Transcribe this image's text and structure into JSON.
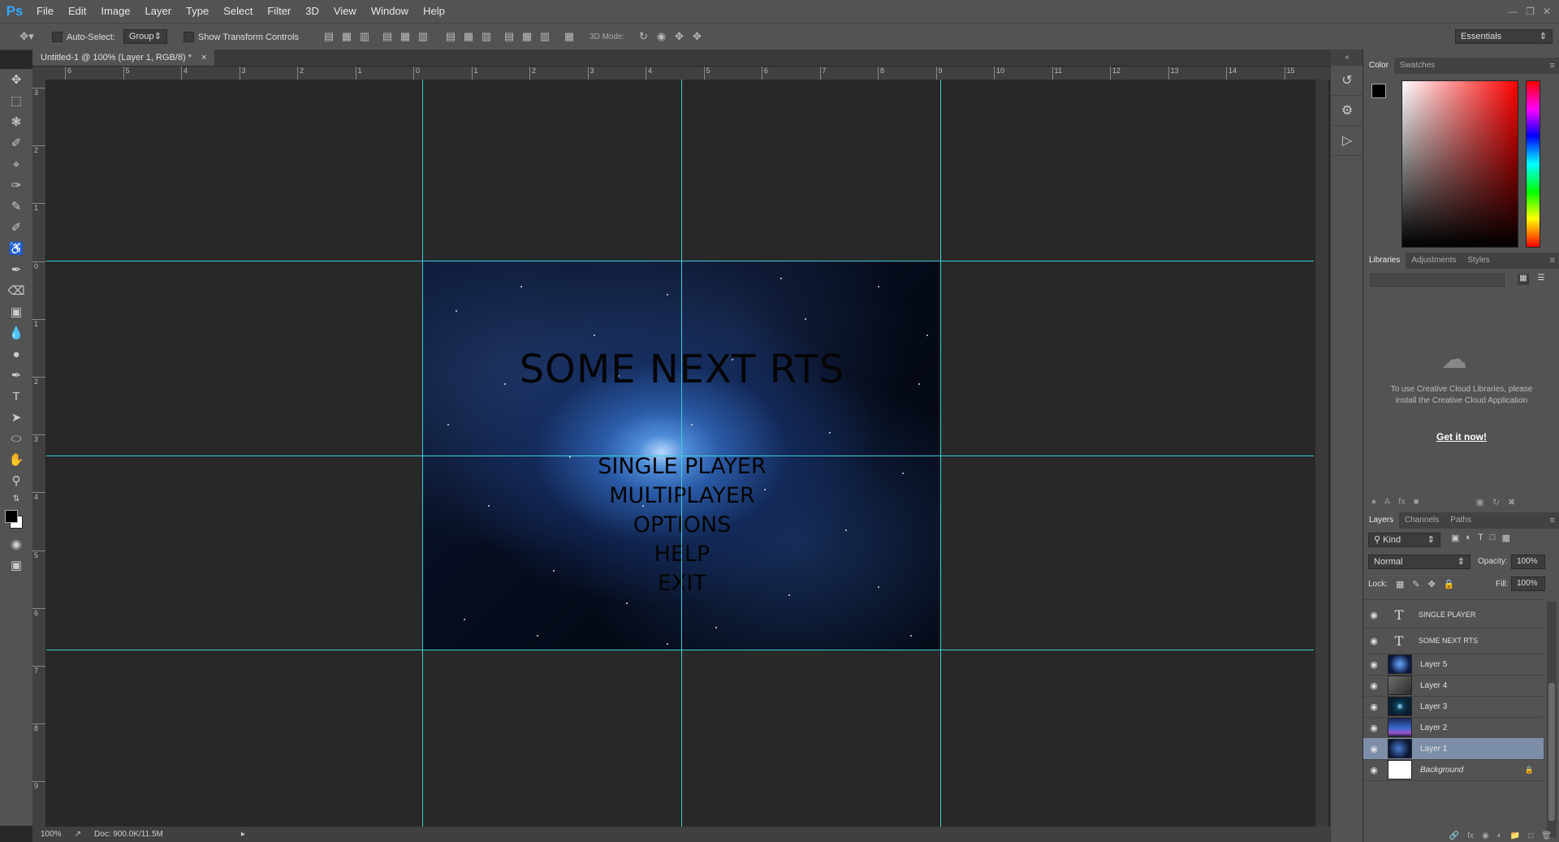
{
  "app": {
    "logo": "Ps",
    "menu": [
      "File",
      "Edit",
      "Image",
      "Layer",
      "Type",
      "Select",
      "Filter",
      "3D",
      "View",
      "Window",
      "Help"
    ],
    "window_controls": [
      "minimize-icon",
      "restore-icon",
      "close-icon"
    ]
  },
  "options_bar": {
    "auto_select_label": "Auto-Select:",
    "auto_select_value": "Group",
    "transform_label": "Show Transform Controls",
    "mode_3d_label": "3D Mode:",
    "workspace": "Essentials"
  },
  "document": {
    "tab_title": "Untitled-1 @ 100% (Layer 1, RGB/8) *",
    "close": "×",
    "zoom": "100%",
    "doc_info": "Doc: 900.0K/11.5M"
  },
  "rulers": {
    "h": [
      "6",
      "5",
      "4",
      "3",
      "2",
      "1",
      "0",
      "1",
      "2",
      "3",
      "4",
      "5",
      "6",
      "7",
      "8",
      "9",
      "10",
      "11",
      "12",
      "13",
      "14",
      "15"
    ],
    "v": [
      "3",
      "2",
      "1",
      "0",
      "1",
      "2",
      "3",
      "4",
      "5",
      "6",
      "7",
      "8",
      "9"
    ]
  },
  "artwork": {
    "title": "SOME NEXT RTS",
    "menu": [
      "SINGLE PLAYER",
      "MULTIPLAYER",
      "OPTIONS",
      "HELP",
      "EXIT"
    ]
  },
  "panels": {
    "color_tabs": [
      "Color",
      "Swatches"
    ],
    "library_tabs": [
      "Libraries",
      "Adjustments",
      "Styles"
    ],
    "library_message": "To use Creative Cloud Libraries, please install the Creative Cloud Application",
    "library_link": "Get it now!",
    "layer_tabs": [
      "Layers",
      "Channels",
      "Paths"
    ],
    "kind_label": "Kind",
    "blend_mode": "Normal",
    "opacity_label": "Opacity:",
    "opacity_value": "100%",
    "lock_label": "Lock:",
    "fill_label": "Fill:",
    "fill_value": "100%",
    "layers": [
      {
        "name": "SINGLE PLAYER",
        "type": "text"
      },
      {
        "name": "SOME NEXT RTS",
        "type": "text"
      },
      {
        "name": "Layer 5",
        "type": "image"
      },
      {
        "name": "Layer 4",
        "type": "image"
      },
      {
        "name": "Layer 3",
        "type": "image"
      },
      {
        "name": "Layer 2",
        "type": "image"
      },
      {
        "name": "Layer 1",
        "type": "image",
        "selected": true
      },
      {
        "name": "Background",
        "type": "background"
      }
    ]
  },
  "colors": {
    "chrome": "#535353",
    "guide": "#3ad0d8",
    "selected_layer": "#7d8fa8"
  }
}
